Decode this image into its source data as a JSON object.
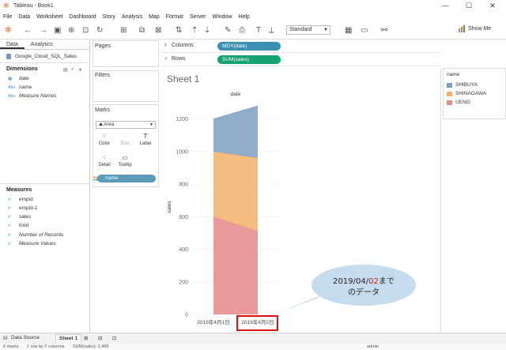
{
  "window": {
    "title": "Tableau - Book1",
    "controls": [
      "—",
      "☐",
      "✕"
    ]
  },
  "menu": [
    "File",
    "Data",
    "Worksheet",
    "Dashboard",
    "Story",
    "Analysis",
    "Map",
    "Format",
    "Server",
    "Window",
    "Help"
  ],
  "toolbar": {
    "fit": "Standard",
    "show_me": "Show Me"
  },
  "left": {
    "tabs": [
      "Data",
      "Analytics"
    ],
    "datasource": "Google_Cloud_SQL_Sales",
    "dimensions_title": "Dimensions",
    "dimensions": [
      {
        "type": "date-icon",
        "label": "date",
        "italic": false
      },
      {
        "type": "abc-icon",
        "label": "name",
        "italic": false
      },
      {
        "type": "abc-icon",
        "label": "Measure Names",
        "italic": true
      }
    ],
    "measures_title": "Measures",
    "measures": [
      {
        "label": "empid",
        "italic": false
      },
      {
        "label": "empid-1",
        "italic": false
      },
      {
        "label": "sales",
        "italic": false
      },
      {
        "label": "trxid",
        "italic": false
      },
      {
        "label": "Number of Records",
        "italic": true
      },
      {
        "label": "Measure Values",
        "italic": true
      }
    ]
  },
  "cards": {
    "pages": "Pages",
    "filters": "Filters",
    "marks": "Marks",
    "mark_type": "Area",
    "buttons": {
      "color": "Color",
      "size": "Size",
      "label": "Label",
      "detail": "Detail",
      "tooltip": "Tooltip"
    },
    "color_field": "name"
  },
  "shelves": {
    "columns_label": "Columns",
    "columns_pill": "MDY(date)",
    "rows_label": "Rows",
    "rows_pill": "SUM(sales)"
  },
  "sheet_title": "Sheet 1",
  "chart_data": {
    "type": "area",
    "title": "",
    "column_header": "date",
    "ylabel": "sales",
    "categories": [
      "2019年4月1日",
      "2019年4月2日"
    ],
    "ylim": [
      0,
      1300
    ],
    "yticks": [
      0,
      200,
      400,
      600,
      800,
      1000,
      1200
    ],
    "series": [
      {
        "name": "UENO",
        "values": [
          600,
          510
        ],
        "color": "#e8888b"
      },
      {
        "name": "SHINAGAWA",
        "values": [
          400,
          450
        ],
        "color": "#f3b068"
      },
      {
        "name": "SHIBUYA",
        "values": [
          200,
          320
        ],
        "color": "#7f9fc0"
      }
    ]
  },
  "legend": {
    "title": "name",
    "items": [
      {
        "label": "SHIBUYA",
        "color": "#7f9fc0"
      },
      {
        "label": "SHINAGAWA",
        "color": "#f3b068"
      },
      {
        "label": "UENO",
        "color": "#e8888b"
      }
    ]
  },
  "callout": {
    "line1_prefix": "2019/04/",
    "line1_red": "02",
    "line1_suffix": "まで",
    "line2": "のデータ"
  },
  "bottom": {
    "datasource_tab": "Data Source",
    "sheet_tab": "Sheet 1"
  },
  "status": {
    "marks": "6 marks",
    "rows": "1 row by 2 columns",
    "sum": "SUM(sales): 2,495",
    "user": "admin"
  }
}
